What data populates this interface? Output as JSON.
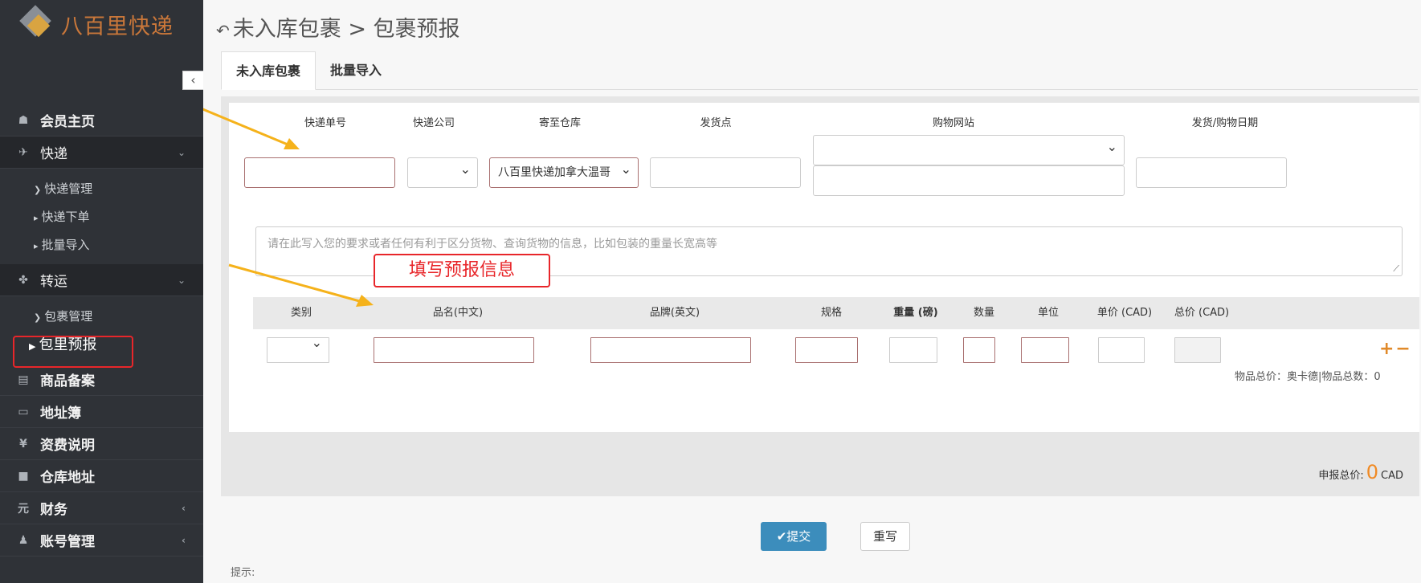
{
  "brand": {
    "name": "八百里快递",
    "logo_icon": "diamond-logo-icon",
    "accent": "#c9773a"
  },
  "sidebar": {
    "collapse_glyph": "‹",
    "items": [
      {
        "icon": "home-icon",
        "glyph": "☗",
        "label": "会员主页"
      },
      {
        "icon": "plane-icon",
        "glyph": "✈",
        "label": "快递",
        "arrow": "⌄",
        "children": [
          {
            "caret": "❯",
            "label": "快递管理"
          },
          {
            "caret": "▸",
            "label": "快递下单"
          },
          {
            "caret": "▸",
            "label": "批量导入"
          }
        ]
      },
      {
        "icon": "transfer-icon",
        "glyph": "✤",
        "label": "转运",
        "arrow": "⌄",
        "children": [
          {
            "caret": "❯",
            "label": "包裹管理"
          },
          {
            "caret": "▶",
            "label": "包里预报"
          }
        ]
      },
      {
        "icon": "chart-icon",
        "glyph": "▤",
        "label": "商品备案"
      },
      {
        "icon": "address-book-icon",
        "glyph": "▭",
        "label": "地址簿"
      },
      {
        "icon": "yen-icon",
        "glyph": "¥",
        "label": "资费说明"
      },
      {
        "icon": "warehouse-icon",
        "glyph": "■",
        "label": "仓库地址"
      },
      {
        "icon": "yuan-icon",
        "glyph": "元",
        "label": "财务",
        "arrow": "‹"
      },
      {
        "icon": "user-icon",
        "glyph": "♟",
        "label": "账号管理",
        "arrow": "‹"
      }
    ]
  },
  "header": {
    "back_glyph": "↶",
    "breadcrumb": "未入库包裹 > 包裹预报"
  },
  "tabs": [
    "未入库包裹",
    "批量导入"
  ],
  "form": {
    "labels": {
      "tracking": "快递单号",
      "courier": "快递公司",
      "warehouse": "寄至仓库",
      "origin": "发货点",
      "shop": "购物网站",
      "date": "发货/购物日期"
    },
    "warehouse_value": "八百里快递加拿大温哥",
    "remark_placeholder": "请在此写入您的要求或者任何有利于区分货物、查询货物的信息，比如包装的重量长宽高等",
    "annotation": "填写预报信息"
  },
  "goods_table": {
    "headers": [
      "类别",
      "品名(中文)",
      "品牌(英文)",
      "规格",
      "重量 (磅)",
      "数量",
      "单位",
      "单价 (CAD)",
      "总价 (CAD)"
    ],
    "add_remove": "+−",
    "summary": "物品总价：奥卡德|物品总数：0"
  },
  "declare": {
    "label": "申报总价:",
    "value": "0",
    "currency": "CAD"
  },
  "buttons": {
    "submit": "✔提交",
    "reset": "重写"
  },
  "tip": "提示:"
}
